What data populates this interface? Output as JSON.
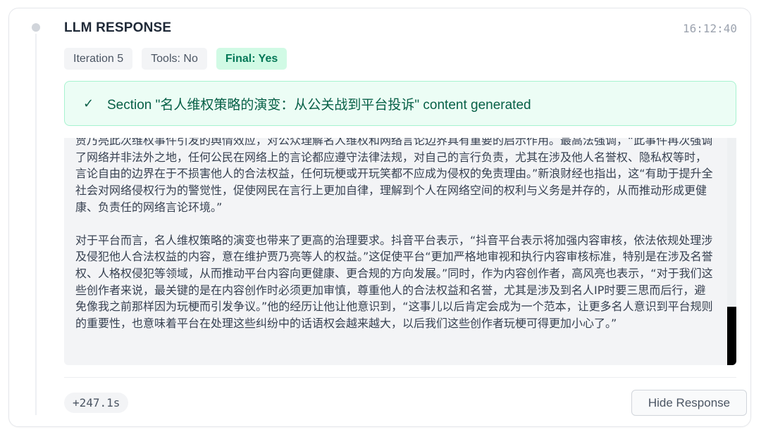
{
  "header": {
    "title": "LLM RESPONSE",
    "timestamp": "16:12:40"
  },
  "badges": {
    "iteration": "Iteration 5",
    "tools": "Tools: No",
    "final": "Final: Yes"
  },
  "banner": {
    "icon": "checkmark-icon",
    "check_glyph": "✓",
    "text": "Section \"名人维权策略的演变：从公关战到平台投诉\" content generated"
  },
  "response": {
    "paragraphs": [
      "贾乃亮此次维权事件引发的舆情效应，对公众理解名人维权和网络言论边界具有重要的启示作用。最高法强调，“此事件再次强调了网络并非法外之地，任何公民在网络上的言论都应遵守法律法规，对自己的言行负责，尤其在涉及他人名誉权、隐私权等时，言论自由的边界在于不损害他人的合法权益，任何玩梗或开玩笑都不应成为侵权的免责理由。”新浪财经也指出，这“有助于提升全社会对网络侵权行为的警觉性，促使网民在言行上更加自律，理解到个人在网络空间的权利与义务是并存的，从而推动形成更健康、负责任的网络言论环境。”",
      "对于平台而言，名人维权策略的演变也带来了更高的治理要求。抖音平台表示，“抖音平台表示将加强内容审核，依法依规处理涉及侵犯他人合法权益的内容，意在维护贾乃亮等人的权益。”这促使平台“更加严格地审视和执行内容审核标准，特别是在涉及名誉权、人格权侵犯等领域，从而推动平台内容向更健康、更合规的方向发展。”同时，作为内容创作者，高风亮也表示，“对于我们这些创作者来说，最关键的是在内容创作时必须更加审慎，尊重他人的合法权益和名誉，尤其是涉及到名人IP时要三思而后行，避免像我之前那样因为玩梗而引发争议。”他的经历让他让他意识到，“这事儿以后肯定会成为一个范本，让更多名人意识到平台规则的重要性，也意味着平台在处理这些纠纷中的话语权会越来越大，以后我们这些创作者玩梗可得更加小心了。”"
    ]
  },
  "footer": {
    "elapsed": "+247.1s",
    "hide_button": "Hide Response"
  },
  "colors": {
    "success_bg": "#ecfdf5",
    "success_border": "#a7f3d0",
    "success_text": "#065f46",
    "final_badge_bg": "#d1fae5",
    "final_badge_text": "#047857"
  }
}
